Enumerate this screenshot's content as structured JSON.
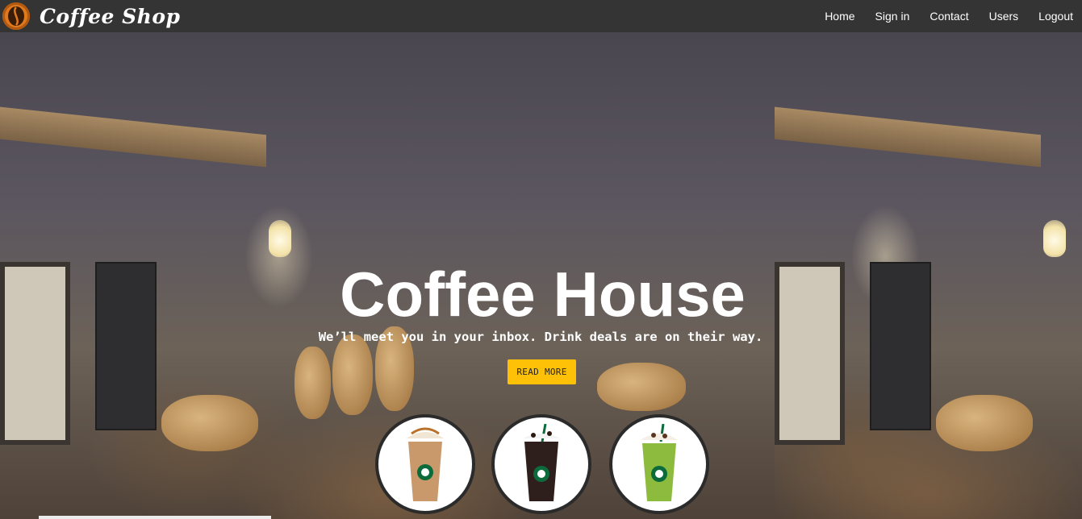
{
  "navbar": {
    "brand_name": "Coffee Shop",
    "brand_icon": "coffee-bean-logo",
    "links": [
      {
        "label": "Home"
      },
      {
        "label": "Sign in"
      },
      {
        "label": "Contact"
      },
      {
        "label": "Users"
      },
      {
        "label": "Logout"
      }
    ]
  },
  "hero": {
    "title": "Coffee House",
    "subtitle": "We’ll meet you in your inbox. Drink deals are on their way.",
    "button_label": "READ MORE",
    "accent_color": "#ffc107",
    "nav_bg": "#343434"
  },
  "drinks": [
    {
      "name": "caramel-frappuccino",
      "icon": "caramel-frappuccino-icon"
    },
    {
      "name": "mocha-cookie-frappuccino",
      "icon": "mocha-frappuccino-icon"
    },
    {
      "name": "matcha-frappuccino",
      "icon": "matcha-frappuccino-icon"
    }
  ]
}
